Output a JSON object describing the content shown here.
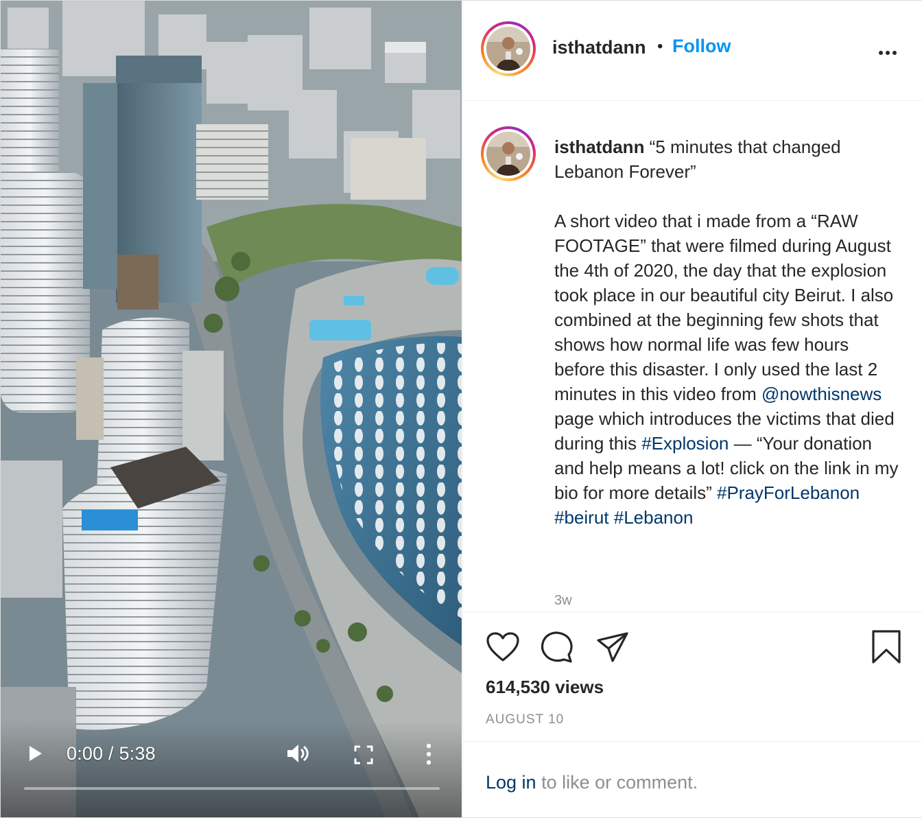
{
  "video": {
    "time_display": "0:00 / 5:38",
    "progress": 0
  },
  "header": {
    "username": "isthatdann",
    "separator": "•",
    "follow_label": "Follow"
  },
  "caption": {
    "username": "isthatdann",
    "line1": " “5 minutes that changed Lebanon Forever”\n\nA short video that i made from a “RAW FOOTAGE” that were filmed during August the 4th of 2020, the day that the explosion took place in our beautiful city Beirut. I also combined at the beginning few shots that shows how normal life was few hours before this disaster. I only used the last 2 minutes in this video from ",
    "mention": "@nowthisnews",
    "line2": " page which introduces the victims that died during this ",
    "tag_explosion": "#Explosion",
    "line3": " — “Your donation and help means a lot! click on the link in my bio for more details” ",
    "tag_pray": "#PrayForLebanon",
    "tag_beirut": "#beirut",
    "tag_lebanon": "#Lebanon",
    "space": " ",
    "age": "3w"
  },
  "stats": {
    "views": "614,530 views",
    "date": "AUGUST 10"
  },
  "login": {
    "link": "Log in",
    "rest": " to like or comment."
  },
  "colors": {
    "follow_blue": "#0095f6",
    "link_blue": "#00376b",
    "muted_gray": "#8e8e8e"
  },
  "icons": {
    "play": "play-icon",
    "volume": "volume-icon",
    "fullscreen": "fullscreen-icon",
    "video_more": "vertical-dots-icon",
    "more": "horizontal-dots-icon",
    "like": "heart-icon",
    "comment": "speech-bubble-icon",
    "share": "paper-plane-icon",
    "save": "bookmark-icon"
  }
}
